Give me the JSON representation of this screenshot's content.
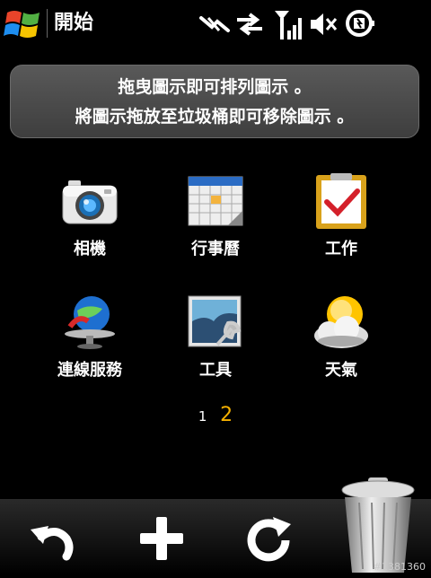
{
  "statusbar": {
    "title": "開始",
    "icons": [
      "windows-start-icon",
      "no-connection-icon",
      "data-sync-icon",
      "signal-strength-icon",
      "volume-muted-icon",
      "battery-charging-icon"
    ]
  },
  "banner": {
    "line1": "拖曳圖示即可排列圖示 。",
    "line2": "將圖示拖放至垃圾桶即可移除圖示 。"
  },
  "apps": [
    {
      "label": "相機",
      "icon": "camera-icon"
    },
    {
      "label": "行事曆",
      "icon": "calendar-icon"
    },
    {
      "label": "工作",
      "icon": "tasks-clipboard-icon"
    },
    {
      "label": "連線服務",
      "icon": "internet-services-icon"
    },
    {
      "label": "工具",
      "icon": "tools-icon"
    },
    {
      "label": "天氣",
      "icon": "weather-icon"
    }
  ],
  "pager": {
    "pages": [
      "1",
      "2"
    ],
    "active": "2"
  },
  "toolbar": {
    "icons": [
      "undo-icon",
      "add-icon",
      "refresh-icon",
      "trash-icon"
    ]
  },
  "watermark": "#1381360",
  "colors": {
    "active_page": "#f6b100",
    "background": "#000000",
    "banner": "#4a4a4a"
  }
}
